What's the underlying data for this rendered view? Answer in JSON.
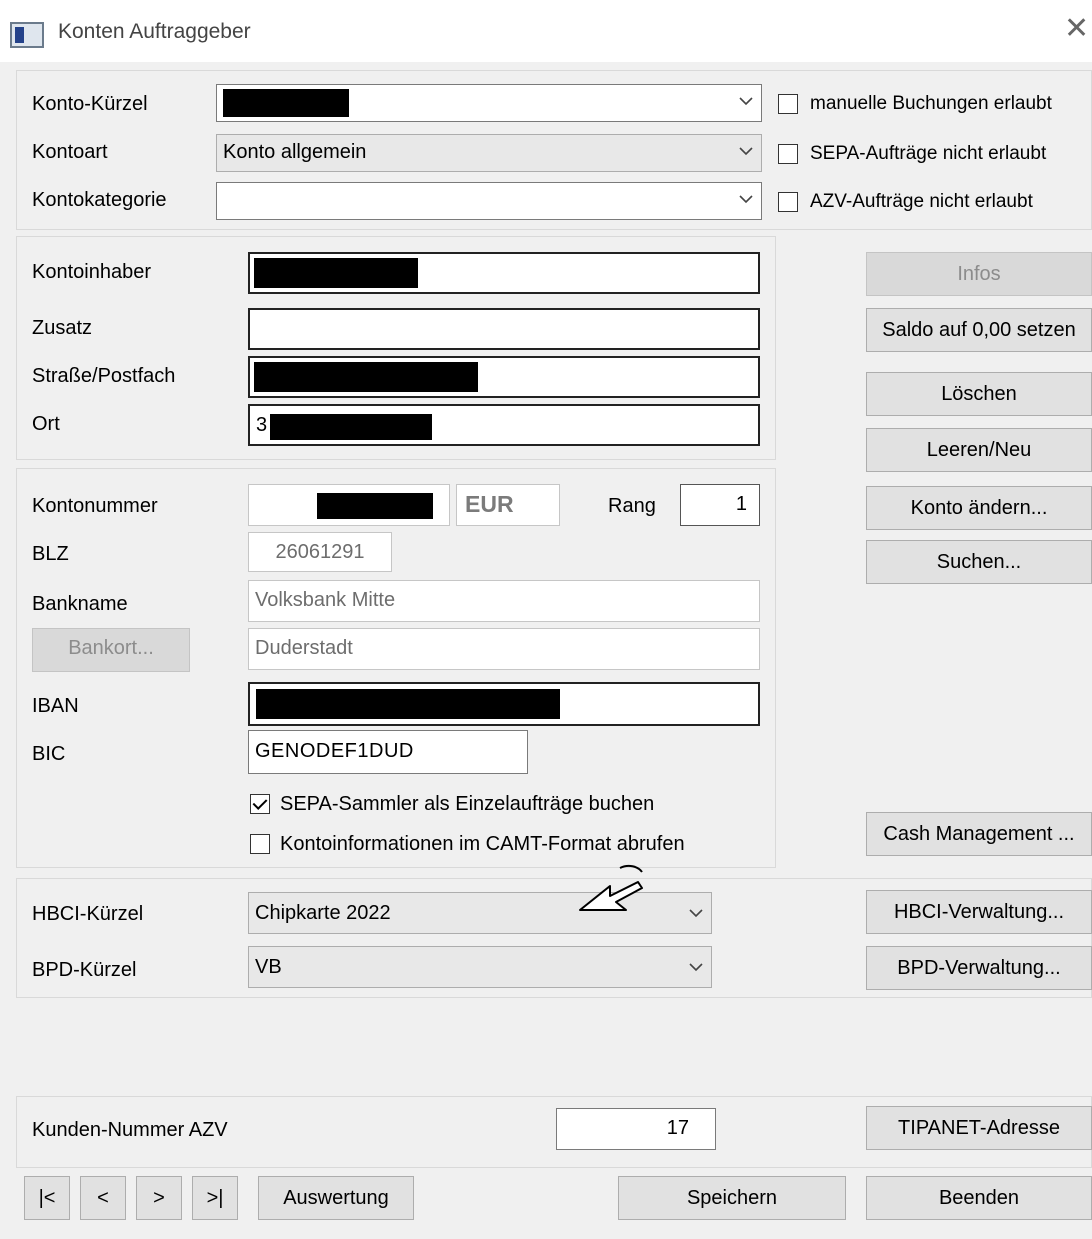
{
  "window": {
    "title": "Konten Auftraggeber"
  },
  "account": {
    "kuerzel_label": "Konto-Kürzel",
    "kontoart_label": "Kontoart",
    "kontoart_value": "Konto allgemein",
    "kategorie_label": "Kontokategorie",
    "kategorie_value": ""
  },
  "checks": {
    "manuelle": "manuelle Buchungen erlaubt",
    "sepa": "SEPA-Aufträge nicht erlaubt",
    "azv": "AZV-Aufträge nicht erlaubt"
  },
  "holder": {
    "inhaber_label": "Kontoinhaber",
    "zusatz_label": "Zusatz",
    "zusatz_value": "",
    "strasse_label": "Straße/Postfach",
    "ort_label": "Ort",
    "ort_prefix": "3"
  },
  "bank": {
    "kontonummer_label": "Kontonummer",
    "currency": "EUR",
    "rang_label": "Rang",
    "rang_value": "1",
    "blz_label": "BLZ",
    "blz_value": "26061291",
    "bankname_label": "Bankname",
    "bankname_value": "Volksbank Mitte",
    "bankort_button": "Bankort...",
    "bankort_value": "Duderstadt",
    "iban_label": "IBAN",
    "bic_label": "BIC",
    "bic_value": "GENODEF1DUD",
    "sepa_sammler": "SEPA-Sammler als Einzelaufträge buchen",
    "camt": "Kontoinformationen im CAMT-Format abrufen"
  },
  "side_buttons": {
    "infos": "Infos",
    "saldo": "Saldo auf 0,00 setzen",
    "loeschen": "Löschen",
    "leeren": "Leeren/Neu",
    "konto_aendern": "Konto ändern...",
    "suchen": "Suchen...",
    "cash": "Cash Management ..."
  },
  "hbci": {
    "hbci_label": "HBCI-Kürzel",
    "hbci_value": "Chipkarte 2022",
    "hbci_button": "HBCI-Verwaltung...",
    "bpd_label": "BPD-Kürzel",
    "bpd_value": "VB",
    "bpd_button": "BPD-Verwaltung..."
  },
  "azv": {
    "label": "Kunden-Nummer AZV",
    "value": "17",
    "button": "TIPANET-Adresse"
  },
  "footer": {
    "first": "|<",
    "prev": "<",
    "next": ">",
    "last": ">|",
    "auswertung": "Auswertung",
    "speichern": "Speichern",
    "beenden": "Beenden"
  }
}
